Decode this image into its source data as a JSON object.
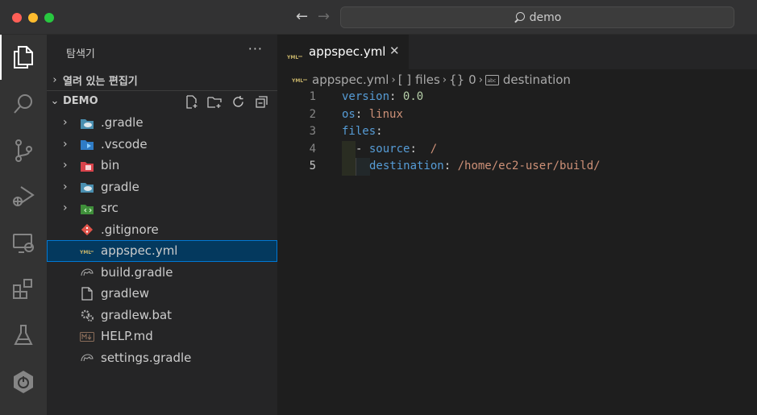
{
  "window": {
    "search_text": "demo",
    "nav_back": "←",
    "nav_forward": "→"
  },
  "activity_bar": {
    "items": [
      {
        "name": "explorer-icon",
        "active": true
      },
      {
        "name": "search-icon"
      },
      {
        "name": "source-control-icon"
      },
      {
        "name": "run-debug-icon"
      },
      {
        "name": "remote-explorer-icon"
      },
      {
        "name": "extensions-icon"
      },
      {
        "name": "testing-icon"
      },
      {
        "name": "spring-boot-icon"
      }
    ]
  },
  "sidebar": {
    "title": "탐색기",
    "more": "···",
    "open_editors_label": "열려 있는 편집기",
    "folder_label": "DEMO",
    "tree": [
      {
        "name": ".gradle",
        "type": "folder",
        "icon": "gradle-folder-icon"
      },
      {
        "name": ".vscode",
        "type": "folder",
        "icon": "vscode-folder-icon"
      },
      {
        "name": "bin",
        "type": "folder",
        "icon": "bin-folder-icon"
      },
      {
        "name": "gradle",
        "type": "folder",
        "icon": "gradle-folder-icon"
      },
      {
        "name": "src",
        "type": "folder",
        "icon": "src-folder-icon"
      },
      {
        "name": ".gitignore",
        "type": "file",
        "icon": "git-icon"
      },
      {
        "name": "appspec.yml",
        "type": "file",
        "icon": "yaml-icon",
        "selected": true
      },
      {
        "name": "build.gradle",
        "type": "file",
        "icon": "gradle-file-icon"
      },
      {
        "name": "gradlew",
        "type": "file",
        "icon": "file-icon"
      },
      {
        "name": "gradlew.bat",
        "type": "file",
        "icon": "settings-file-icon"
      },
      {
        "name": "HELP.md",
        "type": "file",
        "icon": "markdown-icon"
      },
      {
        "name": "settings.gradle",
        "type": "file",
        "icon": "gradle-file-icon"
      }
    ]
  },
  "editor": {
    "tab": {
      "label": "appspec.yml",
      "close": "✕"
    },
    "breadcrumb": {
      "file": "appspec.yml",
      "files_icon": "[ ]",
      "files": "files",
      "item_icon": "{}",
      "item": "0",
      "destination": "destination"
    },
    "lines": [
      {
        "num": "1",
        "key": "version",
        "colon": ":",
        "value": "0.0",
        "value_type": "number"
      },
      {
        "num": "2",
        "key": "os",
        "colon": ":",
        "value": "linux",
        "value_type": "string"
      },
      {
        "num": "3",
        "key": "files",
        "colon": ":",
        "value": "",
        "value_type": "string"
      },
      {
        "num": "4",
        "dash": "- ",
        "key": "source",
        "colon": ":",
        "value": " /",
        "value_type": "string"
      },
      {
        "num": "5",
        "key": "destination",
        "colon": ":",
        "value": "/home/ec2-user/build/",
        "value_type": "string"
      }
    ],
    "current_line": "5"
  },
  "colors": {
    "accent": "#0078d4",
    "selection": "#04395e",
    "yaml_key": "#569cd6",
    "yaml_string": "#ce9178",
    "yaml_number": "#b5cea8"
  }
}
